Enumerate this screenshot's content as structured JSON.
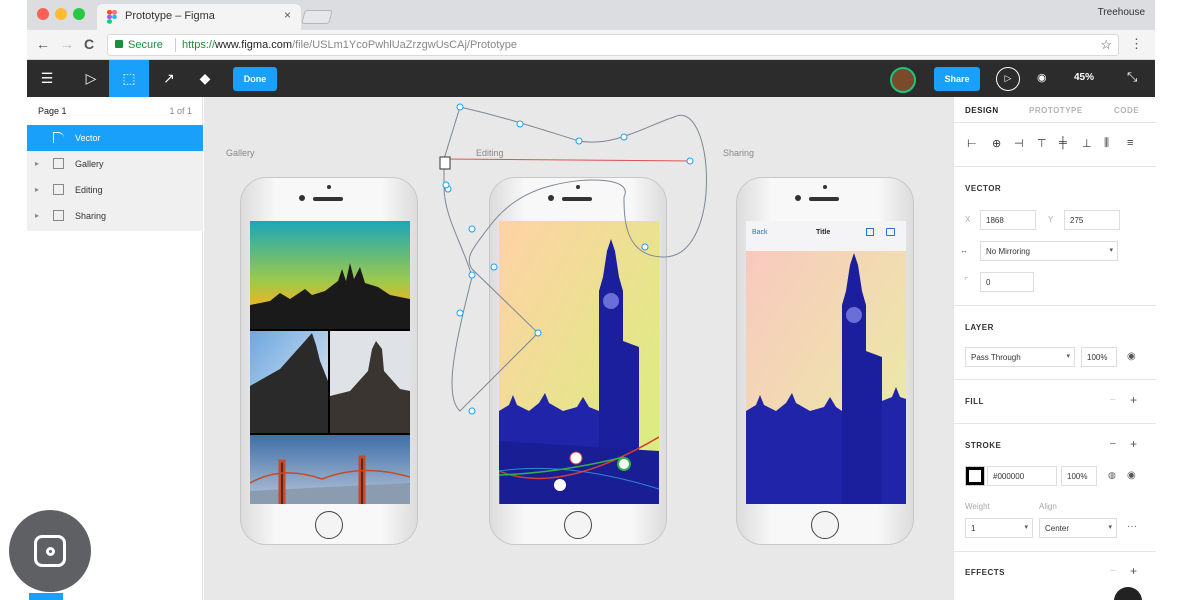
{
  "browser": {
    "tab_title": "Prototype – Figma",
    "tab_close": "×",
    "profile_name": "Treehouse",
    "nav": {
      "back": "←",
      "forward": "→",
      "reload": "C"
    },
    "secure_label": "Secure",
    "url_protocol": "https://",
    "url_host": "www.figma.com",
    "url_path": "/file/USLm1YcoPwhlUaZrzgwUsCAj/Prototype",
    "bookmark_icon": "☆",
    "menu_icon": "⋮"
  },
  "toolbar": {
    "menu_icon": "☰",
    "move_tool": "▷",
    "frame_tool": "⬚",
    "pen_tool": "↗",
    "fill_tool": "◆",
    "done_label": "Done",
    "share_label": "Share",
    "play_icon": "▷",
    "view_icon": "◉",
    "zoom_label": "45%",
    "resize_icon": "⤡"
  },
  "layers": {
    "page_name": "Page 1",
    "page_count": "1 of 1",
    "items": [
      {
        "label": "Vector",
        "selected": true
      },
      {
        "label": "Gallery",
        "selected": false
      },
      {
        "label": "Editing",
        "selected": false
      },
      {
        "label": "Sharing",
        "selected": false
      }
    ]
  },
  "canvas": {
    "frames": [
      {
        "label": "Gallery"
      },
      {
        "label": "Editing"
      },
      {
        "label": "Sharing"
      }
    ],
    "sharing_screen": {
      "back_label": "Back",
      "title": "Title"
    }
  },
  "design_panel": {
    "tabs": [
      "DESIGN",
      "PROTOTYPE",
      "CODE"
    ],
    "vector_title": "VECTOR",
    "x_label": "X",
    "x_value": "1868",
    "y_label": "Y",
    "y_value": "275",
    "mirroring_value": "No Mirroring",
    "radius_value": "0",
    "layer_title": "LAYER",
    "blend_value": "Pass Through",
    "opacity_value": "100%",
    "fill_title": "FILL",
    "stroke_title": "STROKE",
    "stroke_color": "#000000",
    "stroke_opacity": "100%",
    "weight_label": "Weight",
    "align_label": "Align",
    "weight_value": "1",
    "align_value": "Center",
    "effects_title": "EFFECTS",
    "minus": "–",
    "plus": "+"
  },
  "colors": {
    "accent": "#18a0fb",
    "toolbar_bg": "#2c2c2c",
    "canvas_bg": "#e8e8e8"
  }
}
